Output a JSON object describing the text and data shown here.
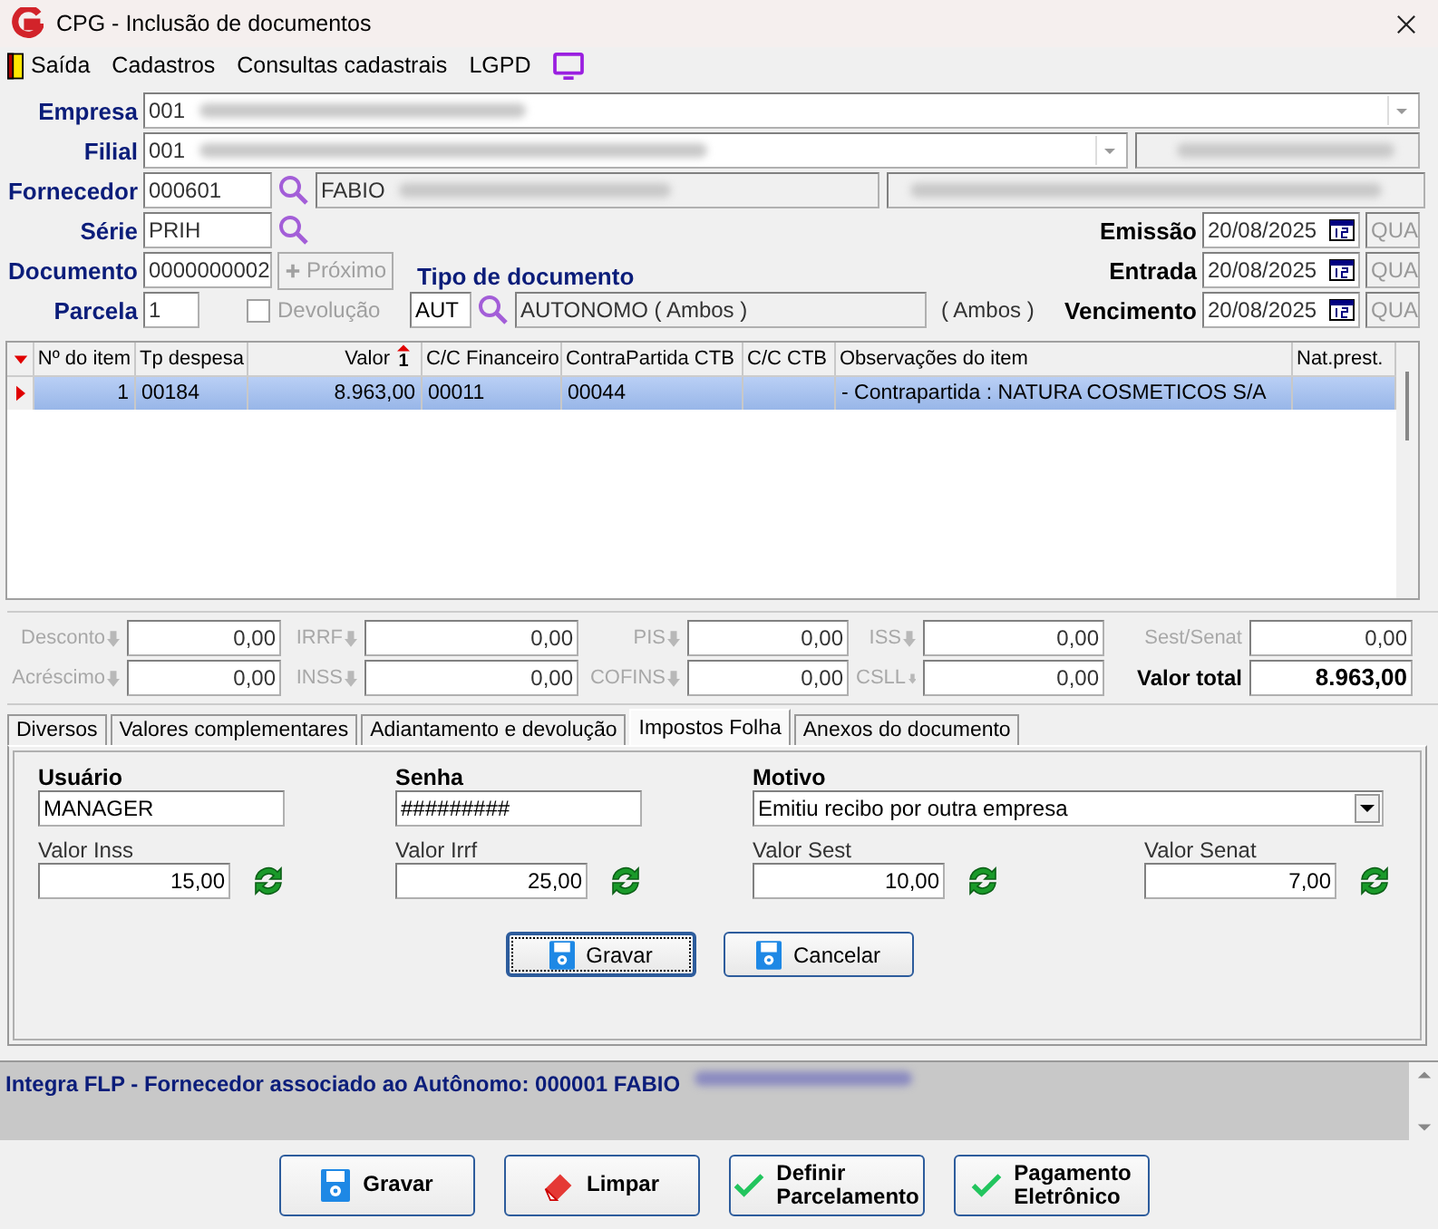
{
  "window": {
    "title": "CPG - Inclusão de documentos"
  },
  "menu": [
    {
      "label": "Saída"
    },
    {
      "label": "Cadastros"
    },
    {
      "label": "Consultas cadastrais"
    },
    {
      "label": "LGPD"
    }
  ],
  "form": {
    "empresa": {
      "label": "Empresa",
      "value": "001"
    },
    "filial": {
      "label": "Filial",
      "value": "001"
    },
    "fornecedor": {
      "label": "Fornecedor",
      "code": "000601",
      "name": "FABIO"
    },
    "serie": {
      "label": "Série",
      "value": "PRIH"
    },
    "documento": {
      "label": "Documento",
      "value": "0000000002"
    },
    "next_button": {
      "label": "Próximo",
      "disabled": true
    },
    "parcela": {
      "label": "Parcela",
      "value": "1"
    },
    "devolucao": {
      "label": "Devolução",
      "checked": false,
      "disabled": true
    },
    "tipo_documento": {
      "label": "Tipo de documento",
      "code": "AUT",
      "description": "AUTONOMO ( Ambos )",
      "note": "( Ambos )"
    },
    "dates": [
      {
        "label": "Emissão",
        "value": "20/08/2025",
        "weekday": "QUA"
      },
      {
        "label": "Entrada",
        "value": "20/08/2025",
        "weekday": "QUA"
      },
      {
        "label": "Vencimento",
        "value": "20/08/2025",
        "weekday": "QUA"
      }
    ]
  },
  "table": {
    "columns": [
      {
        "label": "Nº do item"
      },
      {
        "label": "Tp despesa"
      },
      {
        "label": "Valor",
        "sort": "1"
      },
      {
        "label": "C/C Financeiro"
      },
      {
        "label": "ContraPartida CTB"
      },
      {
        "label": "C/C CTB"
      },
      {
        "label": "Observações do item"
      },
      {
        "label": "Nat.prest."
      }
    ],
    "rows": [
      {
        "selected": true,
        "cells": [
          "1",
          "00184",
          "8.963,00",
          "00011",
          "00044",
          "",
          "- Contrapartida : NATURA COSMETICOS S/A",
          ""
        ]
      }
    ]
  },
  "totals": [
    {
      "label": "Desconto",
      "value": "0,00",
      "kind": "tax",
      "arrow": true
    },
    {
      "label": "IRRF",
      "value": "0,00",
      "kind": "tax",
      "arrow": true
    },
    {
      "label": "PIS",
      "value": "0,00",
      "kind": "tax",
      "arrow": true
    },
    {
      "label": "ISS",
      "value": "0,00",
      "kind": "tax",
      "arrow": true
    },
    {
      "label": "Sest/Senat",
      "value": "0,00",
      "kind": "tax",
      "arrow": false
    },
    {
      "label": "Acréscimo",
      "value": "0,00",
      "kind": "tax",
      "arrow": true
    },
    {
      "label": "INSS",
      "value": "0,00",
      "kind": "tax",
      "arrow": true
    },
    {
      "label": "COFINS",
      "value": "0,00",
      "kind": "tax",
      "arrow": true
    },
    {
      "label": "CSLL",
      "value": "0,00",
      "kind": "tax",
      "arrow": true
    },
    {
      "label": "Valor total",
      "value": "8.963,00",
      "kind": "total",
      "arrow": false
    }
  ],
  "tabs": [
    {
      "label": "Diversos",
      "selected": false
    },
    {
      "label": "Valores complementares",
      "selected": false
    },
    {
      "label": "Adiantamento e devolução",
      "selected": false
    },
    {
      "label": "Impostos Folha",
      "selected": true
    },
    {
      "label": "Anexos do documento",
      "selected": false
    }
  ],
  "panel": {
    "usuario": {
      "label": "Usuário",
      "value": "MANAGER"
    },
    "senha": {
      "label": "Senha",
      "value": "#########"
    },
    "motivo": {
      "label": "Motivo",
      "value": "Emitiu recibo por outra empresa"
    },
    "values": [
      {
        "label": "Valor Inss",
        "value": "15,00"
      },
      {
        "label": "Valor Irrf",
        "value": "25,00"
      },
      {
        "label": "Valor Sest",
        "value": "10,00"
      },
      {
        "label": "Valor Senat",
        "value": "7,00"
      }
    ],
    "buttons": [
      {
        "label": "Gravar",
        "focused": true
      },
      {
        "label": "Cancelar",
        "focused": false
      }
    ]
  },
  "message": {
    "text": "Integra FLP - Fornecedor associado ao Autônomo: 000001 FABIO"
  },
  "footer_buttons": [
    {
      "lines": [
        "Gravar"
      ],
      "kind": "save"
    },
    {
      "lines": [
        "Limpar"
      ],
      "kind": "clear"
    },
    {
      "lines": [
        "Definir",
        "Parcelamento"
      ],
      "kind": "confirm"
    },
    {
      "lines": [
        "Pagamento",
        "Eletrônico"
      ],
      "kind": "confirm"
    }
  ]
}
